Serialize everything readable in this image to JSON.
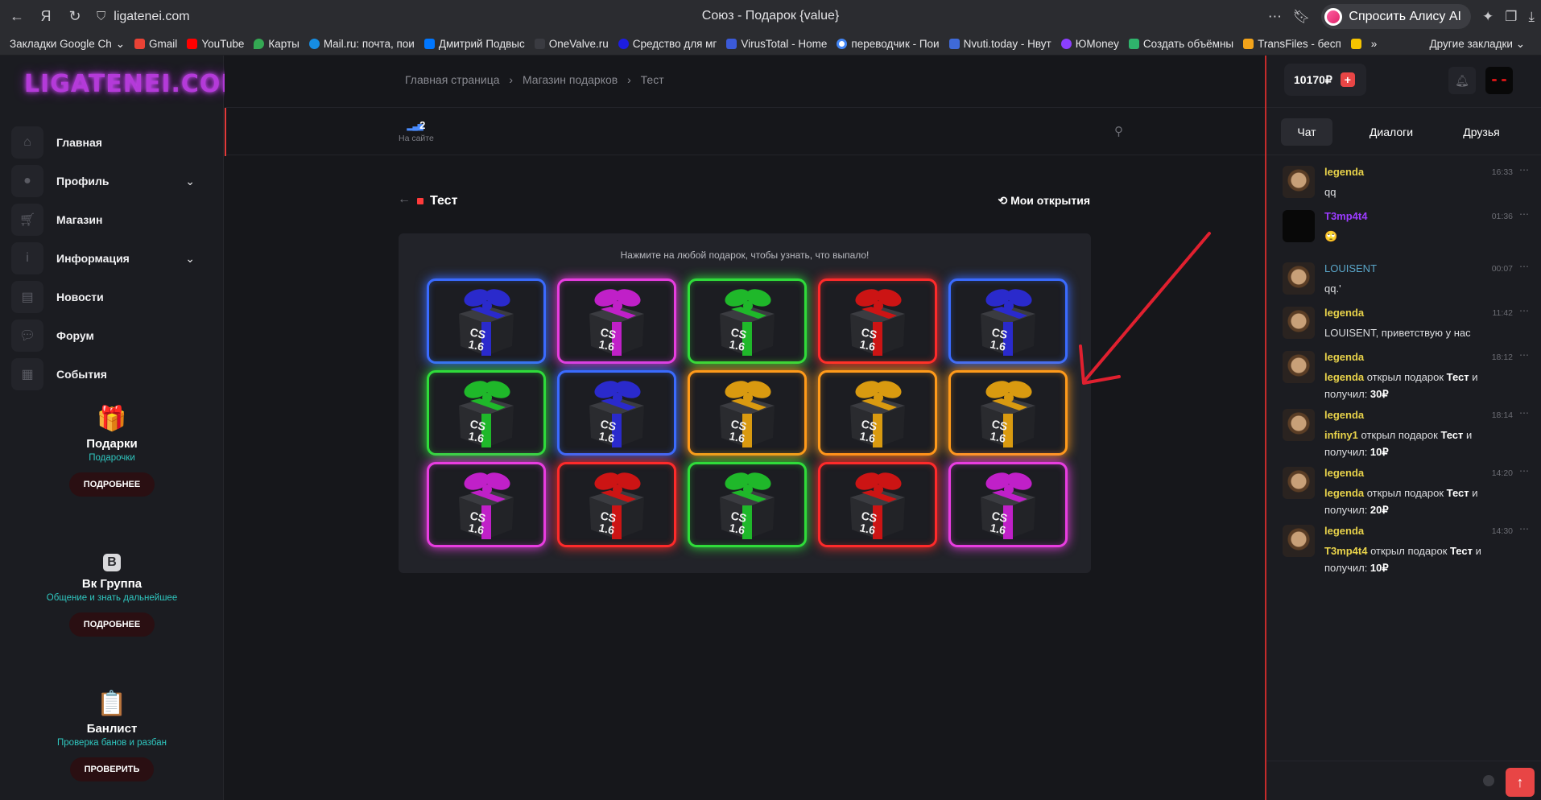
{
  "browser": {
    "url": "ligatenei.com",
    "tab_title": "Союз - Подарок {value}",
    "alice_label": "Спросить Алису AI",
    "bookmarks": [
      "Закладки Google Ch",
      "Gmail",
      "YouTube",
      "Карты",
      "Mail.ru: почта, пои",
      "Дмитрий Подвыс",
      "OneValve.ru",
      "Средство для мг",
      "VirusTotal - Home",
      "переводчик - Пои",
      "Nvuti.today - Нвут",
      "ЮMoney",
      "Создать объёмны",
      "TransFiles - бесп"
    ],
    "bookmarks_more": "»",
    "other_bookmarks": "Другие закладки"
  },
  "sidebar": {
    "logo": "LIGATENEI.COM",
    "menu": [
      {
        "label": "Главная",
        "icon": "home-icon",
        "expand": false
      },
      {
        "label": "Профиль",
        "icon": "user-icon",
        "expand": true
      },
      {
        "label": "Магазин",
        "icon": "cart-icon",
        "expand": false
      },
      {
        "label": "Информация",
        "icon": "info-icon",
        "expand": true
      },
      {
        "label": "Новости",
        "icon": "news-icon",
        "expand": false
      },
      {
        "label": "Форум",
        "icon": "forum-icon",
        "expand": false
      },
      {
        "label": "События",
        "icon": "calendar-icon",
        "expand": false
      }
    ],
    "promos": [
      {
        "title": "Подарки",
        "subtitle": "Подарочки",
        "button": "ПОДРОБНЕЕ",
        "icon": "gift-icon"
      },
      {
        "title": "Вк Группа",
        "subtitle": "Общение и знать дальнейшее",
        "button": "ПОДРОБНЕЕ",
        "icon": "vk-icon"
      },
      {
        "title": "Банлист",
        "subtitle": "Проверка банов и разбан",
        "button": "ПРОВЕРИТЬ",
        "icon": "clipboard-icon"
      }
    ]
  },
  "breadcrumb": [
    "Главная страница",
    "›",
    "Магазин подарков",
    "›",
    "Тест"
  ],
  "online": {
    "count": "2",
    "label": "На сайте"
  },
  "page": {
    "title": "Тест",
    "my_openings": "Мои открытия",
    "hint": "Нажмите на любой подарок, чтобы узнать, что выпало!"
  },
  "gift_box_text": [
    "CS",
    "1.6"
  ],
  "gifts": [
    {
      "color": "#3a6bff",
      "ribbon": "#2a2acc"
    },
    {
      "color": "#e83de0",
      "ribbon": "#c020c8"
    },
    {
      "color": "#2fdc3a",
      "ribbon": "#1fb82a"
    },
    {
      "color": "#ff2a2a",
      "ribbon": "#cc1414"
    },
    {
      "color": "#3a6bff",
      "ribbon": "#2a2acc"
    },
    {
      "color": "#2fdc3a",
      "ribbon": "#1fb82a"
    },
    {
      "color": "#3a6bff",
      "ribbon": "#2a2acc"
    },
    {
      "color": "#ff9a1a",
      "ribbon": "#d99a10"
    },
    {
      "color": "#ff9a1a",
      "ribbon": "#d99a10"
    },
    {
      "color": "#ff9a1a",
      "ribbon": "#d99a10"
    },
    {
      "color": "#e83de0",
      "ribbon": "#c020c8"
    },
    {
      "color": "#ff2a2a",
      "ribbon": "#cc1414"
    },
    {
      "color": "#2fdc3a",
      "ribbon": "#1fb82a"
    },
    {
      "color": "#ff2a2a",
      "ribbon": "#cc1414"
    },
    {
      "color": "#e83de0",
      "ribbon": "#c020c8"
    }
  ],
  "user": {
    "balance": "10170₽",
    "add_icon": "plus-icon"
  },
  "right_tabs": [
    "Чат",
    "Диалоги",
    "Друзья"
  ],
  "chat": [
    {
      "name": "legenda",
      "time": "16:33",
      "text": "qq",
      "dark": false
    },
    {
      "name": "T3mp4t4",
      "time": "01:36",
      "text": "🙄",
      "dark": true
    },
    {
      "name": "LOUISENT",
      "time": "00:07",
      "text": "qq.'",
      "dark": false
    },
    {
      "name": "legenda",
      "time": "11:42",
      "text": "LOUISENT, приветствую у нас",
      "dark": false
    },
    {
      "name": "legenda",
      "time": "18:12",
      "actor": "legenda",
      "action": " открыл подарок ",
      "gift": "Тест",
      "mid": " и получил: ",
      "prize": "30₽",
      "dark": false
    },
    {
      "name": "legenda",
      "time": "18:14",
      "actor": "infiny1",
      "action": " открыл подарок ",
      "gift": "Тест",
      "mid": " и получил: ",
      "prize": "10₽",
      "dark": false
    },
    {
      "name": "legenda",
      "time": "14:20",
      "actor": "legenda",
      "action": " открыл подарок ",
      "gift": "Тест",
      "mid": " и получил: ",
      "prize": "20₽",
      "dark": false
    },
    {
      "name": "legenda",
      "time": "14:30",
      "actor": "T3mp4t4",
      "action": " открыл подарок ",
      "gift": "Тест",
      "mid": " и получил: ",
      "prize": "10₽",
      "dark": false
    }
  ]
}
